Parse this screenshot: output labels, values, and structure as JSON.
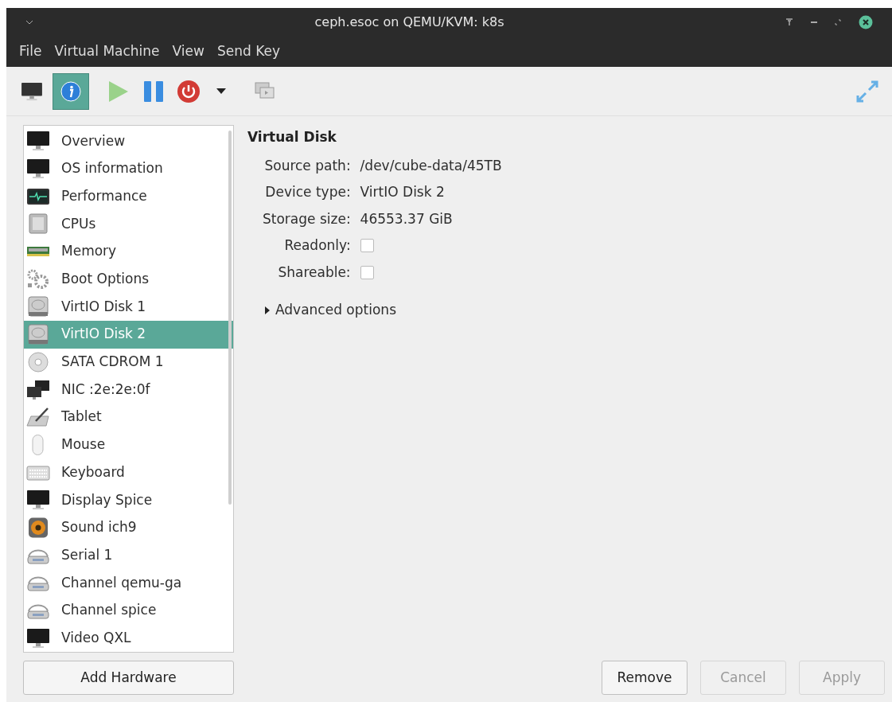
{
  "window": {
    "title": "ceph.esoc on QEMU/KVM: k8s"
  },
  "menu": [
    "File",
    "Virtual Machine",
    "View",
    "Send Key"
  ],
  "toolbar": {
    "details_selected": true
  },
  "sidebar": {
    "items": [
      {
        "label": "Overview",
        "kind": "monitor",
        "selected": false
      },
      {
        "label": "OS information",
        "kind": "monitor",
        "selected": false
      },
      {
        "label": "Performance",
        "kind": "performance",
        "selected": false
      },
      {
        "label": "CPUs",
        "kind": "cpu",
        "selected": false
      },
      {
        "label": "Memory",
        "kind": "memory",
        "selected": false
      },
      {
        "label": "Boot Options",
        "kind": "gears",
        "selected": false
      },
      {
        "label": "VirtIO Disk 1",
        "kind": "disk",
        "selected": false
      },
      {
        "label": "VirtIO Disk 2",
        "kind": "disk",
        "selected": true
      },
      {
        "label": "SATA CDROM 1",
        "kind": "cdrom",
        "selected": false
      },
      {
        "label": "NIC :2e:2e:0f",
        "kind": "nic",
        "selected": false
      },
      {
        "label": "Tablet",
        "kind": "tablet",
        "selected": false
      },
      {
        "label": "Mouse",
        "kind": "mouse",
        "selected": false
      },
      {
        "label": "Keyboard",
        "kind": "keyboard",
        "selected": false
      },
      {
        "label": "Display Spice",
        "kind": "monitor",
        "selected": false
      },
      {
        "label": "Sound ich9",
        "kind": "speaker",
        "selected": false
      },
      {
        "label": "Serial 1",
        "kind": "serial",
        "selected": false
      },
      {
        "label": "Channel qemu-ga",
        "kind": "serial",
        "selected": false
      },
      {
        "label": "Channel spice",
        "kind": "serial",
        "selected": false
      },
      {
        "label": "Video QXL",
        "kind": "monitor",
        "selected": false
      }
    ],
    "add_button": "Add Hardware"
  },
  "details": {
    "title": "Virtual Disk",
    "fields": [
      {
        "label": "Source path:",
        "kind": "text",
        "value": "/dev/cube-data/45TB"
      },
      {
        "label": "Device type:",
        "kind": "text",
        "value": "VirtIO Disk 2"
      },
      {
        "label": "Storage size:",
        "kind": "text",
        "value": "46553.37 GiB"
      },
      {
        "label": "Readonly:",
        "kind": "checkbox",
        "checked": false
      },
      {
        "label": "Shareable:",
        "kind": "checkbox",
        "checked": false
      }
    ],
    "advanced": {
      "label": "Advanced options",
      "expanded": false
    }
  },
  "buttons": [
    {
      "label": "Remove",
      "disabled": false
    },
    {
      "label": "Cancel",
      "disabled": true
    },
    {
      "label": "Apply",
      "disabled": true
    }
  ]
}
